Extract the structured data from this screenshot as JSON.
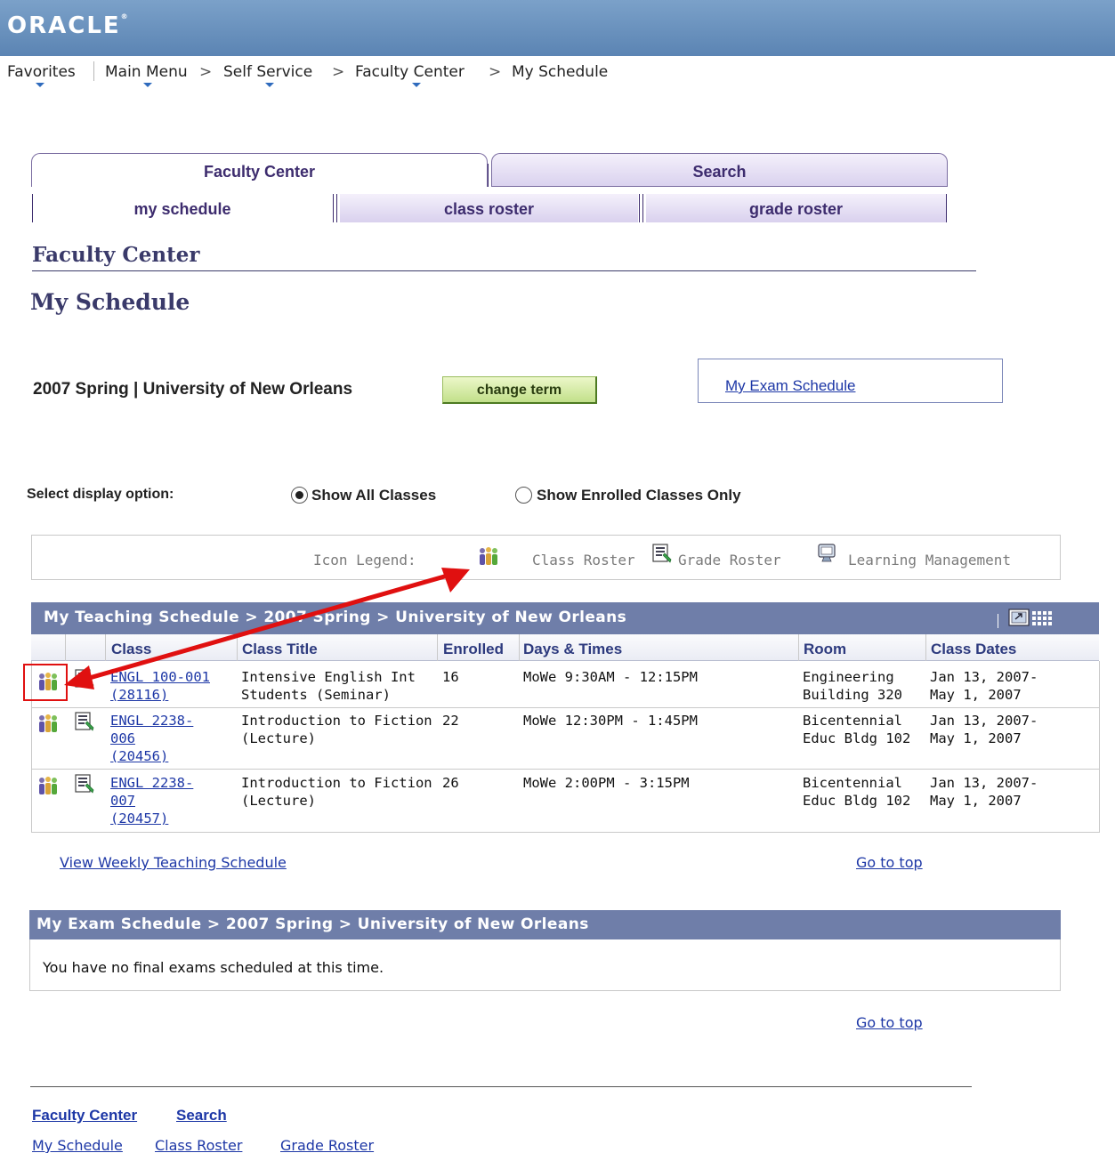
{
  "header": {
    "brand": "ORACLE"
  },
  "nav": {
    "favorites": "Favorites",
    "main_menu": "Main Menu",
    "self_service": "Self Service",
    "faculty_center": "Faculty Center",
    "my_schedule": "My Schedule",
    "separator": ">"
  },
  "tabs": {
    "top": [
      {
        "label": "Faculty Center"
      },
      {
        "label": "Search"
      }
    ],
    "sub": [
      {
        "label": "my schedule"
      },
      {
        "label": "class roster"
      },
      {
        "label": "grade roster"
      }
    ]
  },
  "page": {
    "title": "Faculty Center",
    "subtitle": "My Schedule",
    "term": "2007 Spring | University of New Orleans",
    "change_term": "change term",
    "exam_link": "My Exam Schedule"
  },
  "display_option": {
    "label": "Select display option:",
    "options": [
      "Show All Classes",
      "Show Enrolled Classes Only"
    ],
    "selected": "Show All Classes"
  },
  "legend": {
    "label": "Icon Legend:",
    "class_roster": "Class Roster",
    "grade_roster": "Grade Roster",
    "learning_management": "Learning Management"
  },
  "teaching_schedule": {
    "title": "My Teaching Schedule > 2007 Spring > University of New Orleans",
    "columns": [
      "Class",
      "Class Title",
      "Enrolled",
      "Days & Times",
      "Room",
      "Class Dates"
    ],
    "rows": [
      {
        "class_lines": [
          "ENGL 100-001",
          "(28116)"
        ],
        "title_lines": [
          "Intensive English Int",
          "Students (Seminar)"
        ],
        "enrolled": "16",
        "days_times": "MoWe 9:30AM - 12:15PM",
        "room_lines": [
          "Engineering",
          "Building 320"
        ],
        "dates_lines": [
          "Jan 13, 2007-",
          "May 1, 2007"
        ]
      },
      {
        "class_lines": [
          "ENGL 2238-",
          "006",
          "(20456)"
        ],
        "title_lines": [
          "Introduction to Fiction",
          "(Lecture)"
        ],
        "enrolled": "22",
        "days_times": "MoWe 12:30PM - 1:45PM",
        "room_lines": [
          "Bicentennial",
          "Educ Bldg 102"
        ],
        "dates_lines": [
          "Jan 13, 2007-",
          "May 1, 2007"
        ]
      },
      {
        "class_lines": [
          "ENGL 2238-",
          "007",
          "(20457)"
        ],
        "title_lines": [
          "Introduction to Fiction",
          "(Lecture)"
        ],
        "enrolled": "26",
        "days_times": "MoWe 2:00PM - 3:15PM",
        "room_lines": [
          "Bicentennial",
          "Educ Bldg 102"
        ],
        "dates_lines": [
          "Jan 13, 2007-",
          "May 1, 2007"
        ]
      }
    ],
    "weekly_link": "View Weekly Teaching Schedule",
    "go_to_top": "Go to top"
  },
  "exam_schedule": {
    "title": "My Exam Schedule > 2007 Spring > University of New Orleans",
    "message": "You have no final exams scheduled at this time.",
    "go_to_top": "Go to top"
  },
  "footer": {
    "faculty_center": "Faculty Center",
    "search": "Search",
    "my_schedule": "My Schedule",
    "class_roster": "Class Roster",
    "grade_roster": "Grade Roster"
  },
  "colors": {
    "header_bg": "#6a91bf",
    "grid_header_bg": "#6f7ea9",
    "annotation_red": "#e01010",
    "link": "#1d37a6",
    "button_green": "#c2e08a"
  },
  "icons": [
    "people-icon",
    "grade-roster-icon",
    "learning-management-icon",
    "chevron-down-icon",
    "customize-grid-icon"
  ]
}
